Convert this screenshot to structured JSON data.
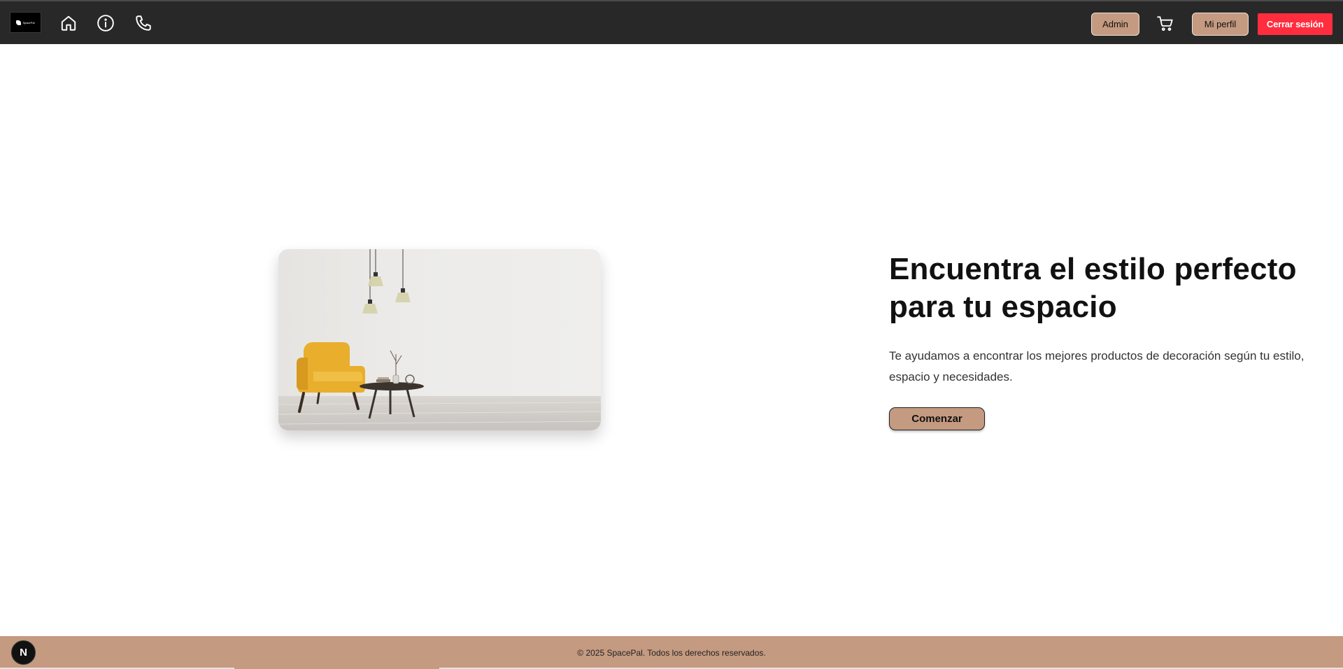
{
  "header": {
    "logo_text": "SpacePal",
    "icons": [
      "home-icon",
      "info-icon",
      "phone-icon",
      "cart-icon"
    ],
    "admin_label": "Admin",
    "profile_label": "Mi perfil",
    "logout_label": "Cerrar sesión"
  },
  "hero": {
    "title": "Encuentra el estilo perfecto para tu espacio",
    "subtitle": "Te ayudamos a encontrar los mejores productos de decoración según tu estilo, espacio y necesidades.",
    "cta_label": "Comenzar"
  },
  "footer": {
    "copyright": "© 2025 SpacePal. Todos los derechos reservados.",
    "dev_badge": "N"
  },
  "colors": {
    "header_bg": "#282828",
    "accent_tan": "#c49a80",
    "logout_red": "#ff2d3d",
    "chair_yellow": "#e8ae2c"
  }
}
